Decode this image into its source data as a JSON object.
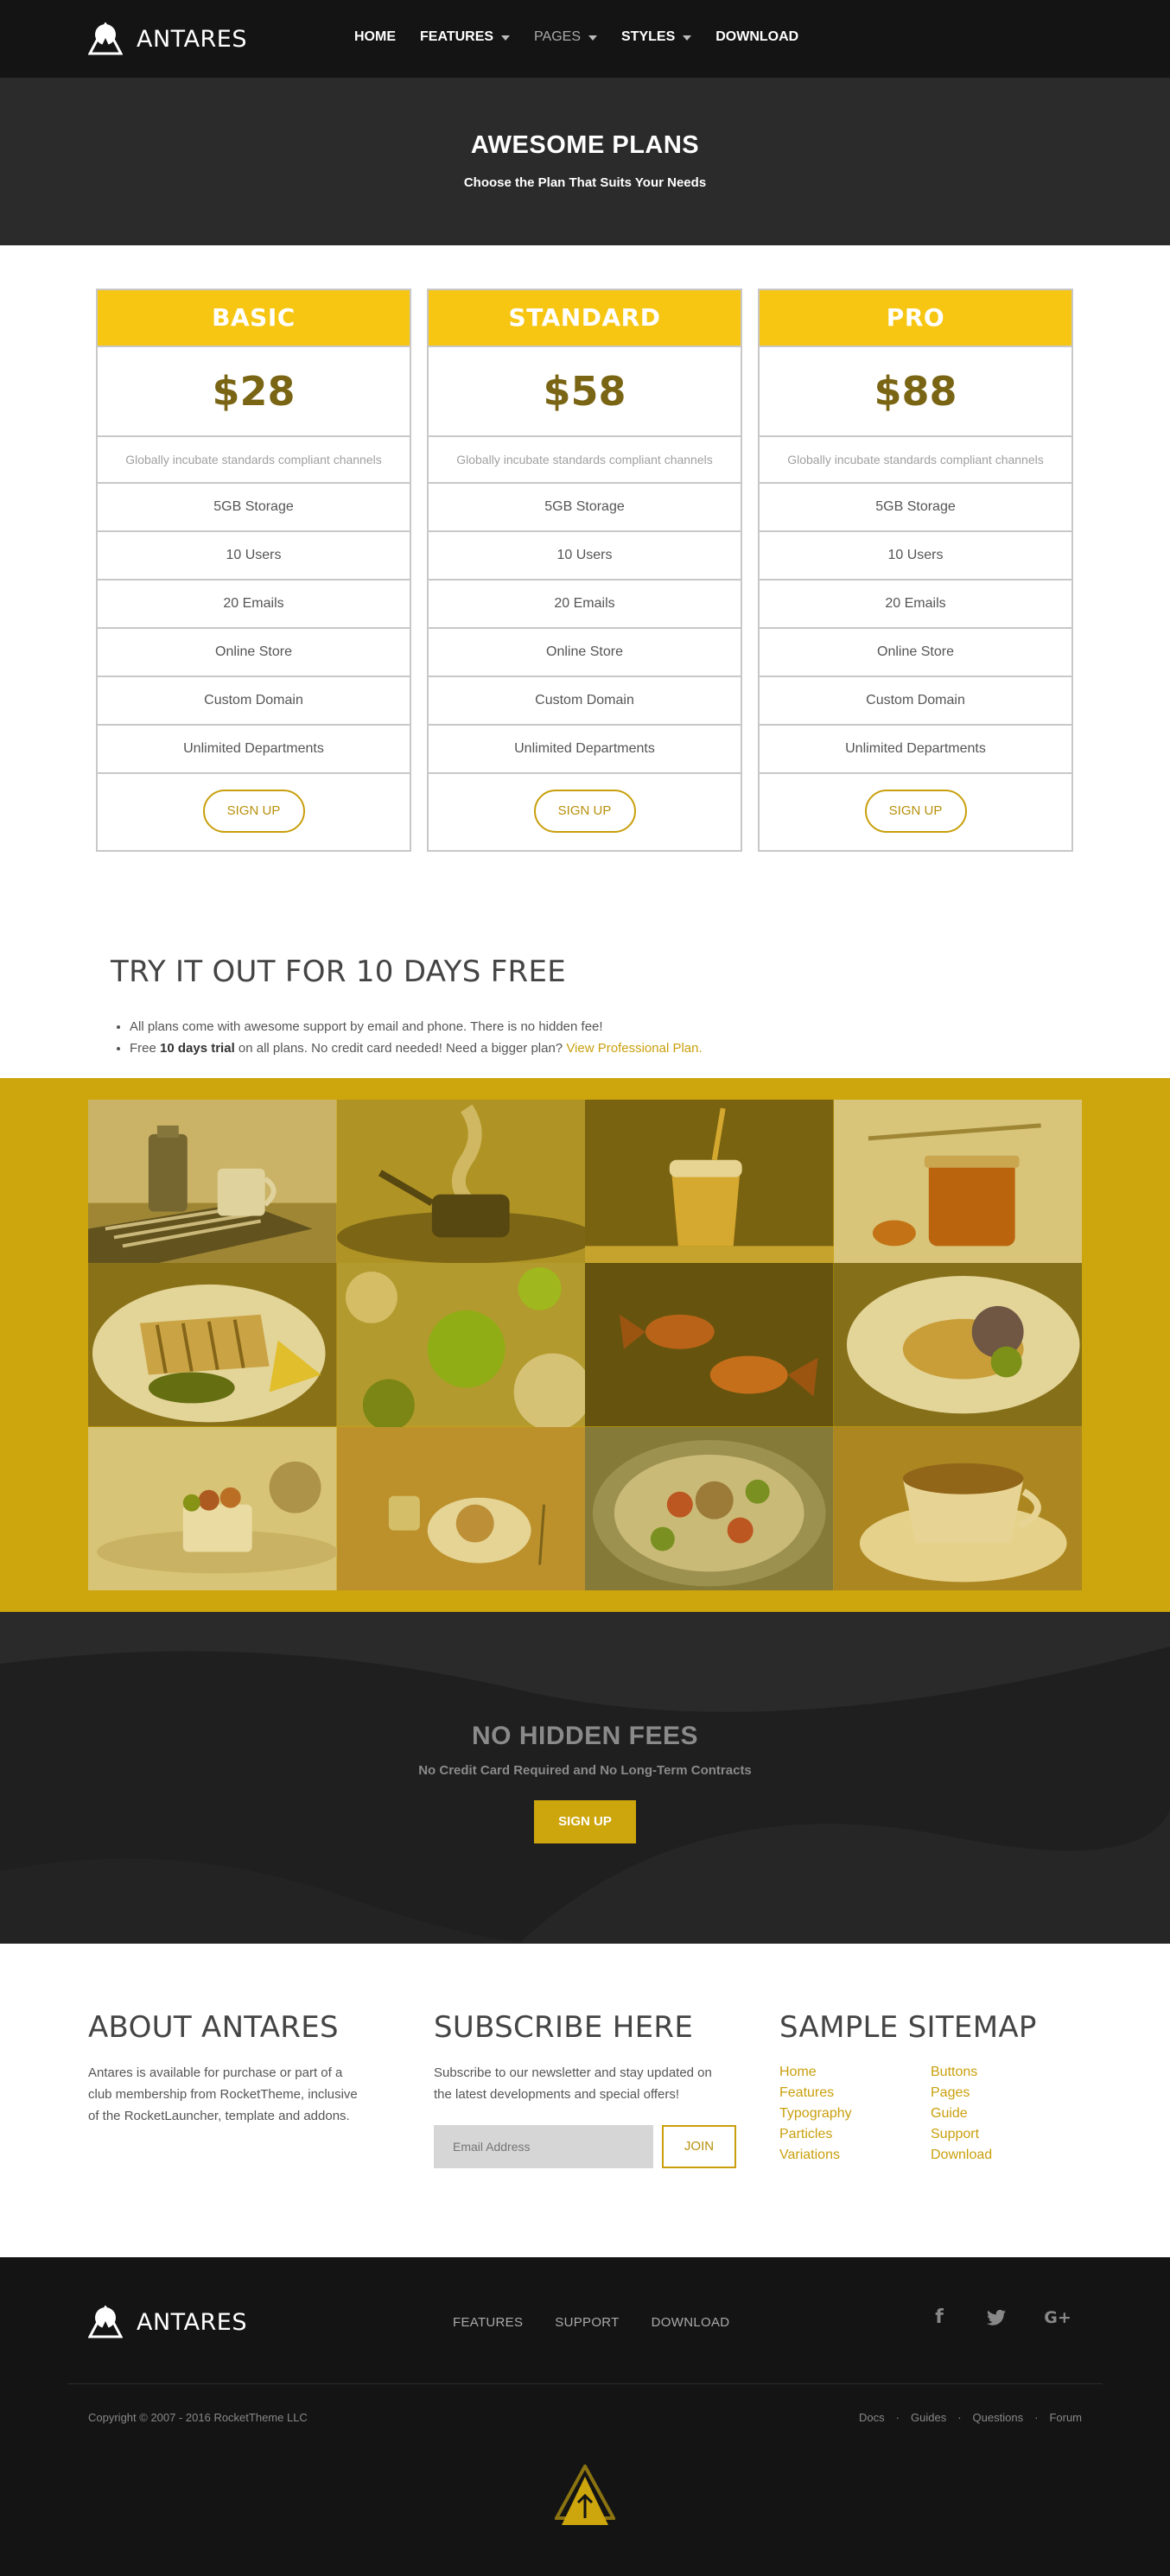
{
  "header": {
    "brand": "ANTARES",
    "nav": [
      {
        "label": "HOME",
        "dropdown": false
      },
      {
        "label": "FEATURES",
        "dropdown": true
      },
      {
        "label": "PAGES",
        "dropdown": true
      },
      {
        "label": "STYLES",
        "dropdown": true
      },
      {
        "label": "DOWNLOAD",
        "dropdown": false
      }
    ]
  },
  "hero": {
    "title": "AWESOME PLANS",
    "subtitle": "Choose the Plan That Suits Your Needs"
  },
  "plans": [
    {
      "name": "BASIC",
      "price": "$28",
      "description": "Globally incubate standards compliant channels",
      "features": [
        "5GB Storage",
        "10 Users",
        "20 Emails",
        "Online Store",
        "Custom Domain",
        "Unlimited Departments"
      ],
      "button": "SIGN UP"
    },
    {
      "name": "STANDARD",
      "price": "$58",
      "description": "Globally incubate standards compliant channels",
      "features": [
        "5GB Storage",
        "10 Users",
        "20 Emails",
        "Online Store",
        "Custom Domain",
        "Unlimited Departments"
      ],
      "button": "SIGN UP"
    },
    {
      "name": "PRO",
      "price": "$88",
      "description": "Globally incubate standards compliant channels",
      "features": [
        "5GB Storage",
        "10 Users",
        "20 Emails",
        "Online Store",
        "Custom Domain",
        "Unlimited Departments"
      ],
      "button": "SIGN UP"
    }
  ],
  "trial": {
    "title": "TRY IT OUT FOR 10 DAYS FREE",
    "bullet1": "All plans come with awesome support by email and phone. There is no hidden fee!",
    "bullet2_prefix": "Free ",
    "bullet2_bold": "10 days trial",
    "bullet2_middle": " on all plans. No credit card needed! Need a bigger plan? ",
    "bullet2_link": "View Professional Plan."
  },
  "gallery": {
    "images": [
      "coffee-pot-and-mug",
      "pan-with-steam",
      "glass-of-beer",
      "honey-jar",
      "grilled-fish-plate",
      "green-flowers",
      "goldfish",
      "salad-plate",
      "cake-dessert",
      "cookie-and-glass",
      "seafood-hotpot",
      "coffee-cup"
    ]
  },
  "cta": {
    "title": "NO HIDDEN FEES",
    "subtitle": "No Credit Card Required and No Long-Term Contracts",
    "button": "SIGN UP"
  },
  "about": {
    "title": "ABOUT ANTARES",
    "line1": "Antares is available for purchase or part of a",
    "line2": "club membership from RocketTheme, inclusive",
    "line3": "of the RocketLauncher, template and addons."
  },
  "subscribe": {
    "title": "SUBSCRIBE HERE",
    "line1": "Subscribe to our newsletter and stay updated on",
    "line2": "the latest developments and special offers!",
    "placeholder": "Email Address",
    "button": "JOIN"
  },
  "sitemap": {
    "title": "SAMPLE SITEMAP",
    "col1": [
      "Home",
      "Features",
      "Typography",
      "Particles",
      "Variations"
    ],
    "col2": [
      "Buttons",
      "Pages",
      "Guide",
      "Support",
      "Download"
    ]
  },
  "footer": {
    "brand": "ANTARES",
    "nav": [
      "FEATURES",
      "SUPPORT",
      "DOWNLOAD"
    ],
    "social": [
      {
        "icon": "facebook-icon",
        "glyph": "f"
      },
      {
        "icon": "twitter-icon",
        "glyph": "🐦"
      },
      {
        "icon": "google-plus-icon",
        "glyph": "G+"
      }
    ],
    "copyright": "Copyright © 2007 - 2016 RocketTheme LLC",
    "links": [
      "Docs",
      "Guides",
      "Questions",
      "Forum"
    ],
    "separator": "·"
  },
  "colors": {
    "accent": "#cda50c",
    "plan_header": "#f6c613",
    "price_text": "#7a6514",
    "dark": "#141414"
  }
}
